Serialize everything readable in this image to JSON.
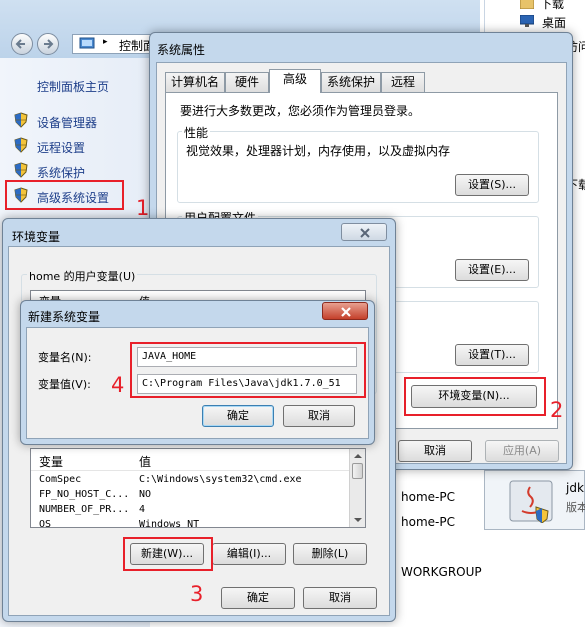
{
  "explorer": {
    "address_text": "控制面",
    "sidebar_home": "控制面板主页",
    "sidebar_items": [
      "设备管理器",
      "远程设置",
      "系统保护",
      "高级系统设置"
    ],
    "right_top_items": [
      "下载",
      "桌面"
    ],
    "right_partial_1": "访问",
    "right_partial_2": "下载",
    "computer_name": "home-PC",
    "full_computer_name": "home-PC",
    "workgroup": "WORKGROUP"
  },
  "jdk_item": {
    "label": "jdk",
    "sub": "版本"
  },
  "sysprops": {
    "title": "系统属性",
    "tabs": [
      "计算机名",
      "硬件",
      "高级",
      "系统保护",
      "远程"
    ],
    "admin_note": "要进行大多数更改，您必须作为管理员登录。",
    "perf_label": "性能",
    "perf_desc": "视觉效果，处理器计划，内存使用，以及虚拟内存",
    "settings_s": "设置(S)...",
    "profile_label": "用户配置文件",
    "settings_e": "设置(E)...",
    "settings_t": "设置(T)...",
    "env_button": "环境变量(N)...",
    "cancel": "取消",
    "apply": "应用(A)"
  },
  "envvars": {
    "title": "环境变量",
    "user_vars_label": "home 的用户变量(U)",
    "col_var_partial": "变量",
    "col_val_partial": "值",
    "sys_col_var": "变量",
    "sys_col_val": "值",
    "sys_rows": [
      {
        "name": "ComSpec",
        "value": "C:\\Windows\\system32\\cmd.exe"
      },
      {
        "name": "FP_NO_HOST_C...",
        "value": "NO"
      },
      {
        "name": "NUMBER_OF_PR...",
        "value": "4"
      },
      {
        "name": "OS",
        "value": "Windows_NT"
      }
    ],
    "new_button": "新建(W)...",
    "edit_button": "编辑(I)...",
    "delete_button": "删除(L)",
    "ok": "确定",
    "cancel": "取消"
  },
  "newvar": {
    "title": "新建系统变量",
    "name_label": "变量名(N):",
    "value_label": "变量值(V):",
    "name_value": "JAVA_HOME",
    "value_value": "C:\\Program Files\\Java\\jdk1.7.0_51",
    "ok": "确定",
    "cancel": "取消"
  },
  "annotations": [
    "1",
    "2",
    "3",
    "4"
  ],
  "colors": {
    "annotation_red": "#e8202a",
    "frame_blue": "#c4d8ec",
    "link_blue": "#1e3f8a"
  }
}
